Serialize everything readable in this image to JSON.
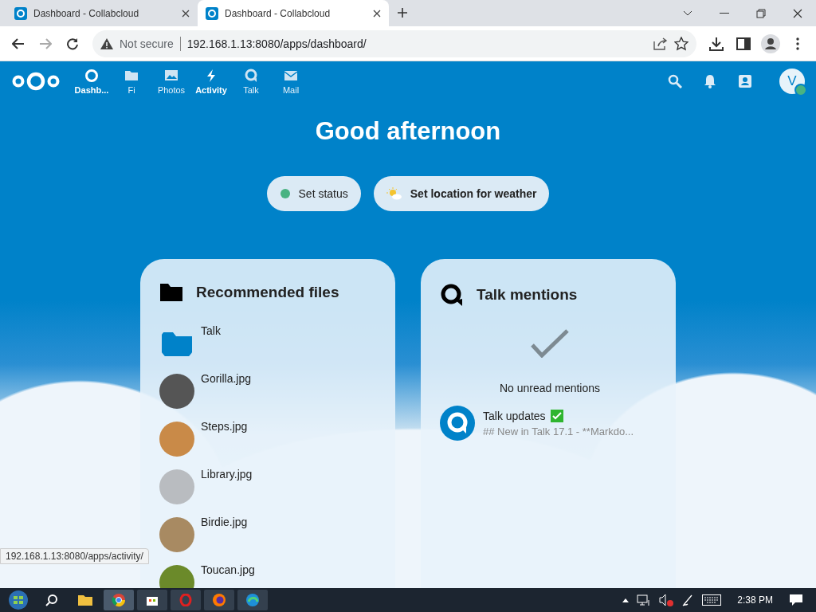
{
  "browser": {
    "tabs": [
      {
        "title": "Dashboard - Collabcloud",
        "selected": false
      },
      {
        "title": "Dashboard - Collabcloud",
        "selected": true
      }
    ],
    "security": "Not secure",
    "url": "192.168.1.13:8080/apps/dashboard/",
    "status_url": "192.168.1.13:8080/apps/activity/"
  },
  "header": {
    "apps": [
      {
        "label": "Dashb...",
        "kind": "dashboard",
        "emphasized": true
      },
      {
        "label": "Fi",
        "kind": "files",
        "emphasized": false
      },
      {
        "label": "Photos",
        "kind": "photos",
        "emphasized": false
      },
      {
        "label": "Activity",
        "kind": "activity",
        "emphasized": true
      },
      {
        "label": "Talk",
        "kind": "talk",
        "emphasized": false
      },
      {
        "label": "Mail",
        "kind": "mail",
        "emphasized": false
      }
    ],
    "avatar": "V"
  },
  "greeting": "Good afternoon",
  "actions": [
    {
      "label": "Set status",
      "kind": "status"
    },
    {
      "label": "Set location for weather",
      "kind": "weather"
    }
  ],
  "recommended": {
    "title": "Recommended files",
    "items": [
      {
        "name": "Talk",
        "kind": "folder"
      },
      {
        "name": "Gorilla.jpg",
        "kind": "image"
      },
      {
        "name": "Steps.jpg",
        "kind": "image"
      },
      {
        "name": "Library.jpg",
        "kind": "image"
      },
      {
        "name": "Birdie.jpg",
        "kind": "image"
      },
      {
        "name": "Toucan.jpg",
        "kind": "image"
      }
    ]
  },
  "talk": {
    "title": "Talk mentions",
    "empty": "No unread mentions",
    "items": [
      {
        "title": "Talk updates",
        "subtitle": "## New in Talk 17.1 - **Markdo..."
      }
    ]
  },
  "taskbar": {
    "time": "2:38 PM"
  }
}
